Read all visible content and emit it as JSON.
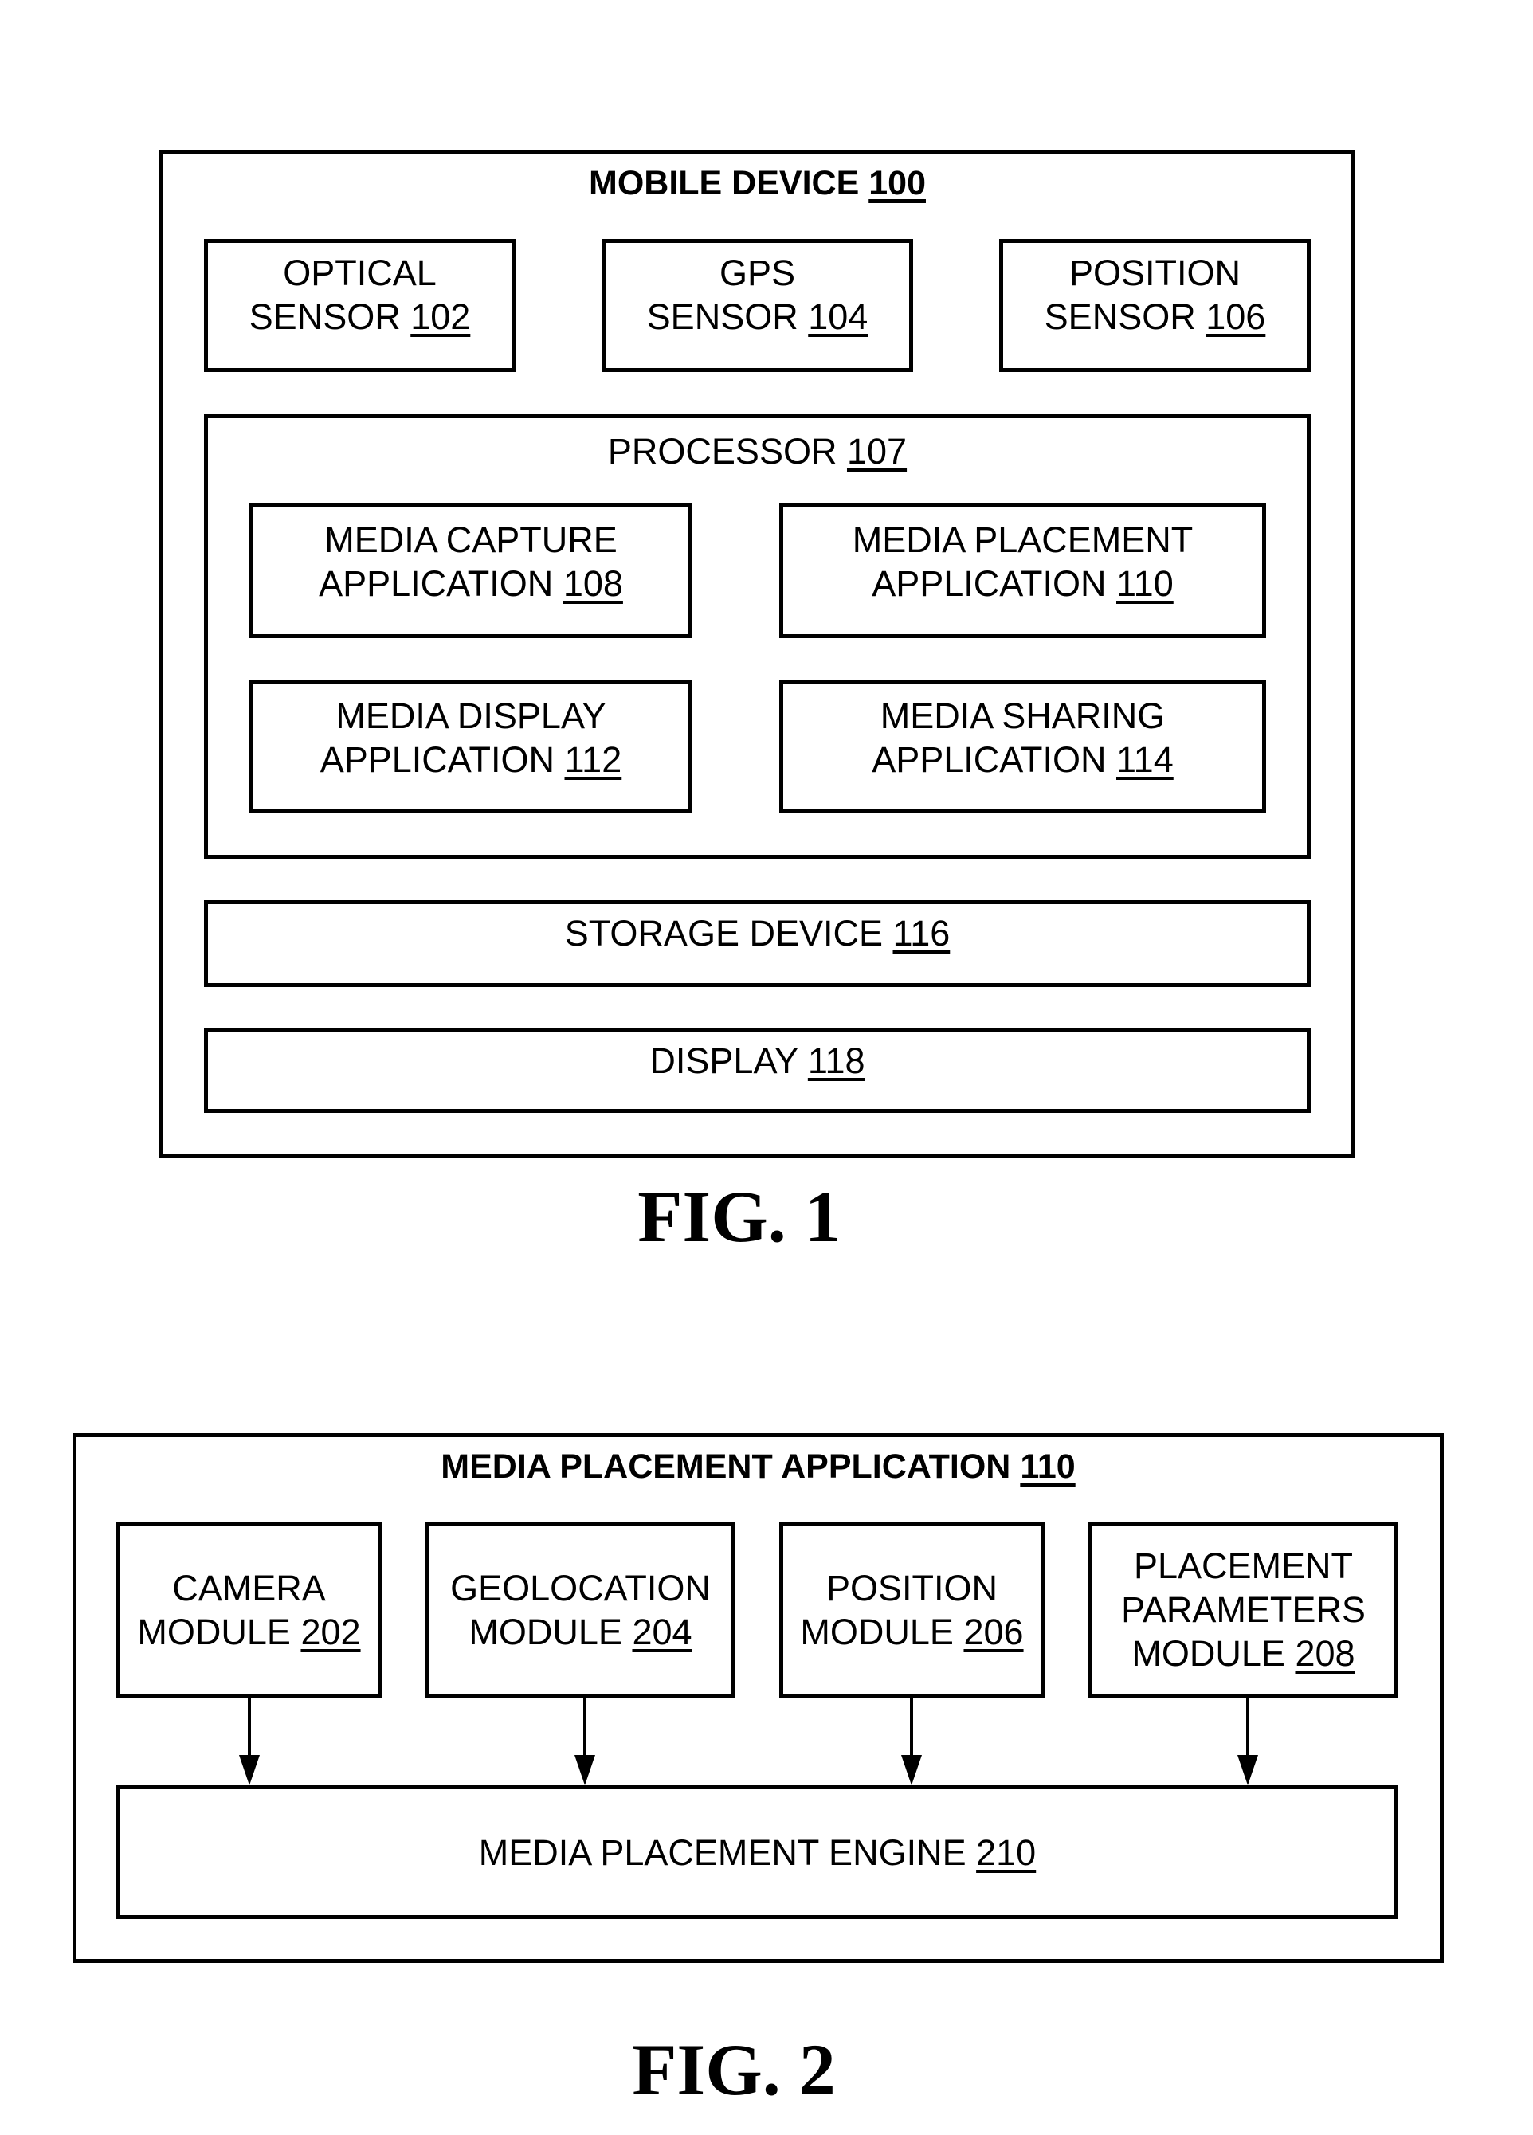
{
  "figure1": {
    "container": {
      "title": "MOBILE DEVICE",
      "ref": "100"
    },
    "sensors": [
      {
        "lines": [
          "OPTICAL",
          "SENSOR"
        ],
        "ref": "102"
      },
      {
        "lines": [
          "GPS",
          "SENSOR"
        ],
        "ref": "104"
      },
      {
        "lines": [
          "POSITION",
          "SENSOR"
        ],
        "ref": "106"
      }
    ],
    "processor": {
      "title": "PROCESSOR",
      "ref": "107",
      "applications": [
        {
          "lines": [
            "MEDIA CAPTURE",
            "APPLICATION"
          ],
          "ref": "108"
        },
        {
          "lines": [
            "MEDIA PLACEMENT",
            "APPLICATION"
          ],
          "ref": "110"
        },
        {
          "lines": [
            "MEDIA DISPLAY",
            "APPLICATION"
          ],
          "ref": "112"
        },
        {
          "lines": [
            "MEDIA SHARING",
            "APPLICATION"
          ],
          "ref": "114"
        }
      ]
    },
    "storage": {
      "title": "STORAGE DEVICE",
      "ref": "116"
    },
    "display": {
      "title": "DISPLAY",
      "ref": "118"
    },
    "caption": "FIG. 1"
  },
  "figure2": {
    "container": {
      "title": "MEDIA PLACEMENT APPLICATION",
      "ref": "110"
    },
    "modules": [
      {
        "lines": [
          "CAMERA",
          "MODULE"
        ],
        "ref": "202"
      },
      {
        "lines": [
          "GEOLOCATION",
          "MODULE"
        ],
        "ref": "204"
      },
      {
        "lines": [
          "POSITION",
          "MODULE"
        ],
        "ref": "206"
      },
      {
        "lines": [
          "PLACEMENT",
          "PARAMETERS",
          "MODULE"
        ],
        "ref": "208"
      }
    ],
    "engine": {
      "title": "MEDIA PLACEMENT ENGINE",
      "ref": "210"
    },
    "arrows": [
      {
        "from": "CAMERA MODULE 202",
        "to": "MEDIA PLACEMENT ENGINE 210"
      },
      {
        "from": "GEOLOCATION MODULE 204",
        "to": "MEDIA PLACEMENT ENGINE 210"
      },
      {
        "from": "POSITION MODULE 206",
        "to": "MEDIA PLACEMENT ENGINE 210"
      },
      {
        "from": "PLACEMENT PARAMETERS MODULE 208",
        "to": "MEDIA PLACEMENT ENGINE 210"
      }
    ],
    "caption": "FIG. 2"
  }
}
